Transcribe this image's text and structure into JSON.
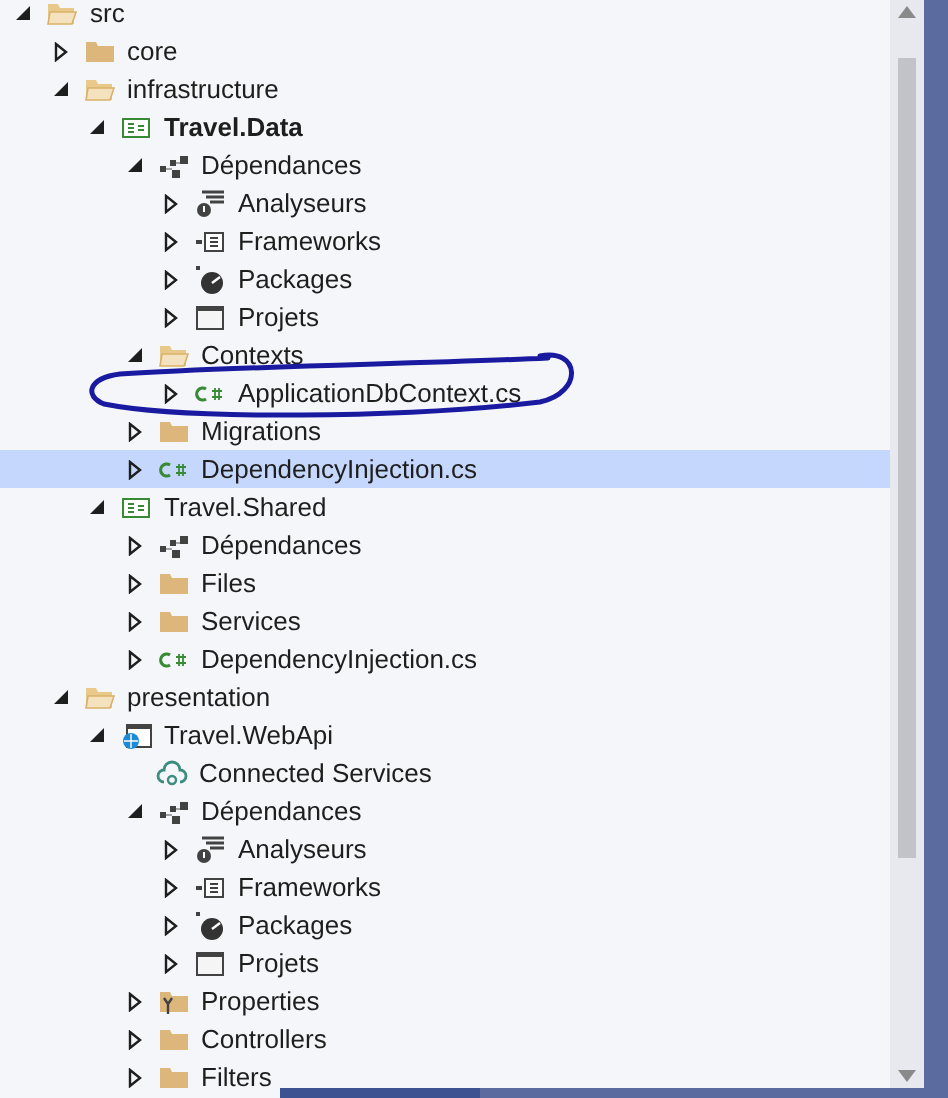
{
  "tree": [
    {
      "label": "src",
      "kind": "folder",
      "expanded": true,
      "selected": false,
      "children": [
        {
          "label": "core",
          "kind": "folder",
          "expanded": false,
          "selected": false
        },
        {
          "label": "infrastructure",
          "kind": "folder",
          "expanded": true,
          "selected": false,
          "children": [
            {
              "label": "Travel.Data",
              "kind": "project",
              "startup": true,
              "expanded": true,
              "selected": false,
              "children": [
                {
                  "label": "Dépendances",
                  "kind": "dependencies",
                  "expanded": true,
                  "selected": false,
                  "children": [
                    {
                      "label": "Analyseurs",
                      "kind": "analyzers",
                      "expanded": false,
                      "selected": false
                    },
                    {
                      "label": "Frameworks",
                      "kind": "frameworks",
                      "expanded": false,
                      "selected": false
                    },
                    {
                      "label": "Packages",
                      "kind": "packages",
                      "expanded": false,
                      "selected": false
                    },
                    {
                      "label": "Projets",
                      "kind": "projects",
                      "expanded": false,
                      "selected": false
                    }
                  ]
                },
                {
                  "label": "Contexts",
                  "kind": "folder",
                  "expanded": true,
                  "selected": false,
                  "children": [
                    {
                      "label": "ApplicationDbContext.cs",
                      "kind": "csfile",
                      "expanded": false,
                      "selected": false
                    }
                  ]
                },
                {
                  "label": "Migrations",
                  "kind": "folder",
                  "expanded": false,
                  "selected": false
                },
                {
                  "label": "DependencyInjection.cs",
                  "kind": "csfile",
                  "expanded": false,
                  "selected": true
                }
              ]
            },
            {
              "label": "Travel.Shared",
              "kind": "project",
              "startup": false,
              "expanded": true,
              "selected": false,
              "children": [
                {
                  "label": "Dépendances",
                  "kind": "dependencies",
                  "expanded": false,
                  "selected": false
                },
                {
                  "label": "Files",
                  "kind": "folder",
                  "expanded": false,
                  "selected": false
                },
                {
                  "label": "Services",
                  "kind": "folder",
                  "expanded": false,
                  "selected": false
                },
                {
                  "label": "DependencyInjection.cs",
                  "kind": "csfile",
                  "expanded": false,
                  "selected": false
                }
              ]
            }
          ]
        },
        {
          "label": "presentation",
          "kind": "folder",
          "expanded": true,
          "selected": false,
          "children": [
            {
              "label": "Travel.WebApi",
              "kind": "webproject",
              "startup": false,
              "expanded": true,
              "selected": false,
              "children": [
                {
                  "label": "Connected Services",
                  "kind": "connected",
                  "selected": false
                },
                {
                  "label": "Dépendances",
                  "kind": "dependencies",
                  "expanded": true,
                  "selected": false,
                  "children": [
                    {
                      "label": "Analyseurs",
                      "kind": "analyzers",
                      "expanded": false,
                      "selected": false
                    },
                    {
                      "label": "Frameworks",
                      "kind": "frameworks",
                      "expanded": false,
                      "selected": false
                    },
                    {
                      "label": "Packages",
                      "kind": "packages",
                      "expanded": false,
                      "selected": false
                    },
                    {
                      "label": "Projets",
                      "kind": "projects",
                      "expanded": false,
                      "selected": false
                    }
                  ]
                },
                {
                  "label": "Properties",
                  "kind": "properties",
                  "expanded": false,
                  "selected": false
                },
                {
                  "label": "Controllers",
                  "kind": "folder",
                  "expanded": false,
                  "selected": false
                },
                {
                  "label": "Filters",
                  "kind": "folder",
                  "expanded": false,
                  "selected": false
                }
              ]
            }
          ]
        }
      ]
    }
  ]
}
